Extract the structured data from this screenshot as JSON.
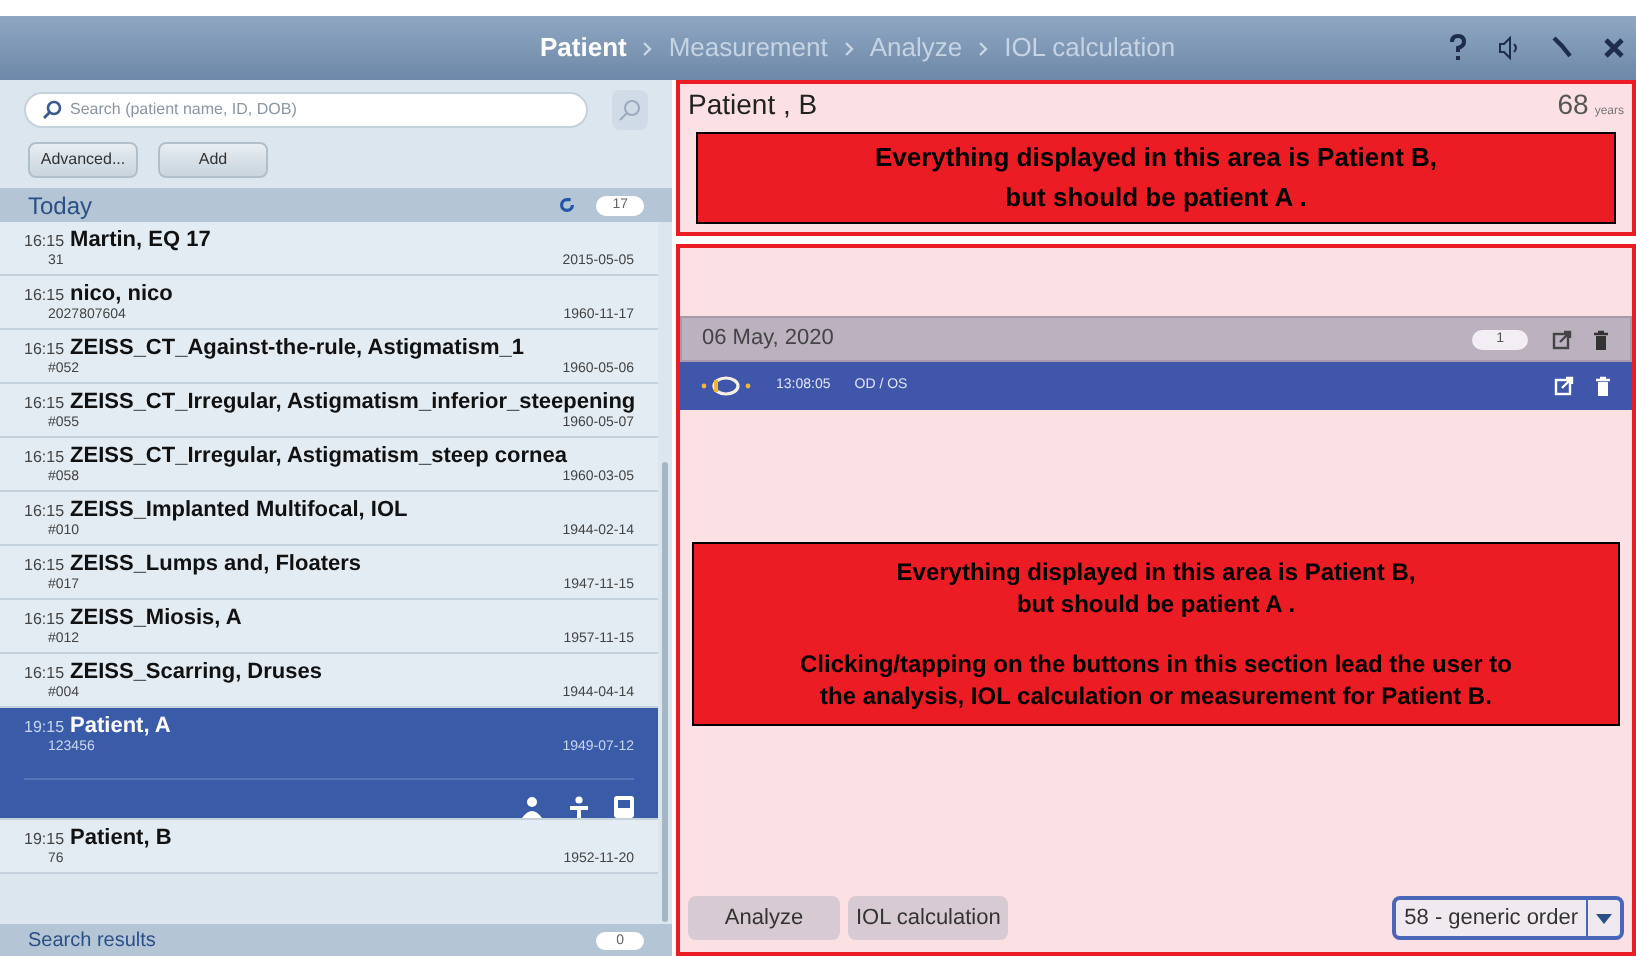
{
  "breadcrumb": [
    {
      "label": "Patient",
      "selected": true
    },
    {
      "label": "Measurement",
      "selected": false
    },
    {
      "label": "Analyze",
      "selected": false
    },
    {
      "label": "IOL calculation",
      "selected": false
    }
  ],
  "search": {
    "placeholder": "Search (patient name, ID, DOB)"
  },
  "left_buttons": [
    "Advanced...",
    "Add"
  ],
  "today": {
    "title": "Today",
    "count": "17"
  },
  "patients": [
    {
      "time": "16:15",
      "name": "Martin, EQ 17",
      "id": "31",
      "dob": "2015-05-05",
      "selected": false
    },
    {
      "time": "16:15",
      "name": "nico, nico",
      "id": "2027807604",
      "dob": "1960-11-17",
      "selected": false
    },
    {
      "time": "16:15",
      "name": "ZEISS_CT_Against-the-rule, Astigmatism_1",
      "id": "#052",
      "dob": "1960-05-06",
      "selected": false
    },
    {
      "time": "16:15",
      "name": "ZEISS_CT_Irregular, Astigmatism_inferior_steepening",
      "id": "#055",
      "dob": "1960-05-07",
      "selected": false
    },
    {
      "time": "16:15",
      "name": "ZEISS_CT_Irregular, Astigmatism_steep cornea",
      "id": "#058",
      "dob": "1960-03-05",
      "selected": false
    },
    {
      "time": "16:15",
      "name": "ZEISS_Implanted Multifocal, IOL",
      "id": "#010",
      "dob": "1944-02-14",
      "selected": false
    },
    {
      "time": "16:15",
      "name": "ZEISS_Lumps and, Floaters",
      "id": "#017",
      "dob": "1947-11-15",
      "selected": false
    },
    {
      "time": "16:15",
      "name": "ZEISS_Miosis, A",
      "id": "#012",
      "dob": "1957-11-15",
      "selected": false
    },
    {
      "time": "16:15",
      "name": "ZEISS_Scarring, Druses",
      "id": "#004",
      "dob": "1944-04-14",
      "selected": false
    },
    {
      "time": "19:15",
      "name": "Patient, A",
      "id": "123456",
      "dob": "1949-07-12",
      "selected": true
    },
    {
      "time": "19:15",
      "name": "Patient, B",
      "id": "76",
      "dob": "1952-11-20",
      "selected": false
    }
  ],
  "search_results": {
    "title": "Search results",
    "count": "0"
  },
  "patient_header": {
    "name": "Patient , B",
    "age": "68",
    "age_unit": "years"
  },
  "annotation_top": [
    "Everything displayed in this area is Patient B,",
    "but should be patient A ."
  ],
  "visit": {
    "date": "06 May, 2020",
    "count": "1",
    "measurements": [
      {
        "time": "13:08:05",
        "eyes": "OD / OS"
      }
    ]
  },
  "annotation_bottom": [
    [
      "Everything displayed in this area is Patient B,",
      "but should be patient A ."
    ],
    [
      "Clicking/tapping on the buttons in this section lead the user to",
      "the analysis, IOL calculation or measurement for Patient B."
    ]
  ],
  "bottom_buttons": [
    "Analyze",
    "IOL calculation"
  ],
  "order_select": {
    "value": "58 - generic order"
  }
}
